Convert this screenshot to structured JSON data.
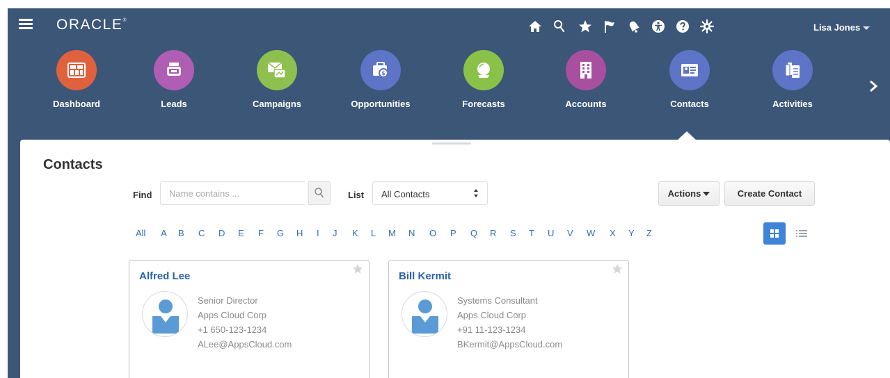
{
  "app": {
    "brand": "ORACLE",
    "trademark": "®"
  },
  "user": {
    "name": "Lisa Jones"
  },
  "top_icons": [
    "home-icon",
    "search-icon",
    "favorites-star-icon",
    "watchlist-flag-icon",
    "notifications-bell-icon",
    "accessibility-icon",
    "help-icon",
    "settings-gear-icon"
  ],
  "nav": {
    "items": [
      {
        "label": "Dashboard",
        "icon": "dashboard-icon",
        "color": "#e0613e"
      },
      {
        "label": "Leads",
        "icon": "leads-icon",
        "color": "#b05db4"
      },
      {
        "label": "Campaigns",
        "icon": "campaigns-icon",
        "color": "#8dc04f"
      },
      {
        "label": "Opportunities",
        "icon": "opportunities-icon",
        "color": "#5d74c7"
      },
      {
        "label": "Forecasts",
        "icon": "forecasts-icon",
        "color": "#8ac149"
      },
      {
        "label": "Accounts",
        "icon": "accounts-icon",
        "color": "#a94f9f"
      },
      {
        "label": "Contacts",
        "icon": "contacts-icon",
        "color": "#5d74c7"
      },
      {
        "label": "Activities",
        "icon": "activities-icon",
        "color": "#5d74c7"
      }
    ],
    "selected": "Contacts"
  },
  "main": {
    "title": "Contacts",
    "find": {
      "label": "Find",
      "placeholder": "Name contains ...",
      "value": ""
    },
    "list": {
      "label": "List",
      "selected": "All Contacts"
    },
    "actions_label": "Actions",
    "create_label": "Create Contact",
    "alphabet": [
      "All",
      "A",
      "B",
      "C",
      "D",
      "E",
      "F",
      "G",
      "H",
      "I",
      "J",
      "K",
      "L",
      "M",
      "N",
      "O",
      "P",
      "Q",
      "R",
      "S",
      "T",
      "U",
      "V",
      "W",
      "X",
      "Y",
      "Z"
    ],
    "view_mode": "grid"
  },
  "contacts": [
    {
      "name": "Alfred Lee",
      "title": "Senior Director",
      "company": "Apps Cloud Corp",
      "phone": "+1 650-123-1234",
      "email": "ALee@AppsCloud.com"
    },
    {
      "name": "Bill Kermit",
      "title": "Systems Consultant",
      "company": "Apps Cloud Corp",
      "phone": "+91 11-123-1234",
      "email": "BKermit@AppsCloud.com"
    }
  ],
  "colors": {
    "header_bg": "#3c5678",
    "link": "#2f6db5",
    "accent": "#3f84d6"
  }
}
